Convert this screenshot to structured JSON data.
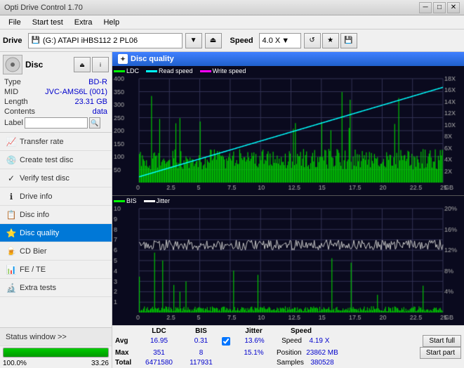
{
  "titlebar": {
    "title": "Opti Drive Control 1.70",
    "min_btn": "─",
    "max_btn": "□",
    "close_btn": "✕"
  },
  "menubar": {
    "items": [
      "File",
      "Start test",
      "Extra",
      "Help"
    ]
  },
  "drivebar": {
    "drive_label": "Drive",
    "drive_value": "(G:) ATAPI iHBS112 2 PL06",
    "speed_label": "Speed",
    "speed_value": "4.0 X"
  },
  "disc": {
    "title": "Disc",
    "type_label": "Type",
    "type_value": "BD-R",
    "mid_label": "MID",
    "mid_value": "JVC-AMS6L (001)",
    "length_label": "Length",
    "length_value": "23.31 GB",
    "contents_label": "Contents",
    "contents_value": "data",
    "label_label": "Label",
    "label_placeholder": ""
  },
  "sidebar": {
    "items": [
      {
        "id": "transfer-rate",
        "label": "Transfer rate",
        "icon": "📈"
      },
      {
        "id": "create-test-disc",
        "label": "Create test disc",
        "icon": "💿"
      },
      {
        "id": "verify-test-disc",
        "label": "Verify test disc",
        "icon": "✓"
      },
      {
        "id": "drive-info",
        "label": "Drive info",
        "icon": "ℹ"
      },
      {
        "id": "disc-info",
        "label": "Disc info",
        "icon": "📋"
      },
      {
        "id": "disc-quality",
        "label": "Disc quality",
        "icon": "⭐",
        "active": true
      },
      {
        "id": "cd-bier",
        "label": "CD Bier",
        "icon": "🍺"
      },
      {
        "id": "fe-te",
        "label": "FE / TE",
        "icon": "📊"
      },
      {
        "id": "extra-tests",
        "label": "Extra tests",
        "icon": "🔬"
      }
    ]
  },
  "status": {
    "status_window_label": "Status window >>",
    "progress_value": 100,
    "progress_label": "100.0%",
    "status_right": "33.26"
  },
  "disc_quality": {
    "title": "Disc quality",
    "legend": {
      "ldc": "LDC",
      "read_speed": "Read speed",
      "write_speed": "Write speed",
      "bis": "BIS",
      "jitter": "Jitter"
    },
    "stats": {
      "columns": [
        "LDC",
        "BIS",
        "",
        "Jitter",
        "Speed",
        ""
      ],
      "avg_label": "Avg",
      "avg_ldc": "16.95",
      "avg_bis": "0.31",
      "avg_jitter": "13.6%",
      "avg_speed": "4.19 X",
      "max_label": "Max",
      "max_ldc": "351",
      "max_bis": "8",
      "max_jitter": "15.1%",
      "position_label": "Position",
      "position_value": "23862 MB",
      "total_label": "Total",
      "total_ldc": "6471580",
      "total_bis": "117931",
      "samples_label": "Samples",
      "samples_value": "380528",
      "jitter_checked": true,
      "speed_value": "4.0 X",
      "start_full_label": "Start full",
      "start_part_label": "Start part"
    }
  }
}
